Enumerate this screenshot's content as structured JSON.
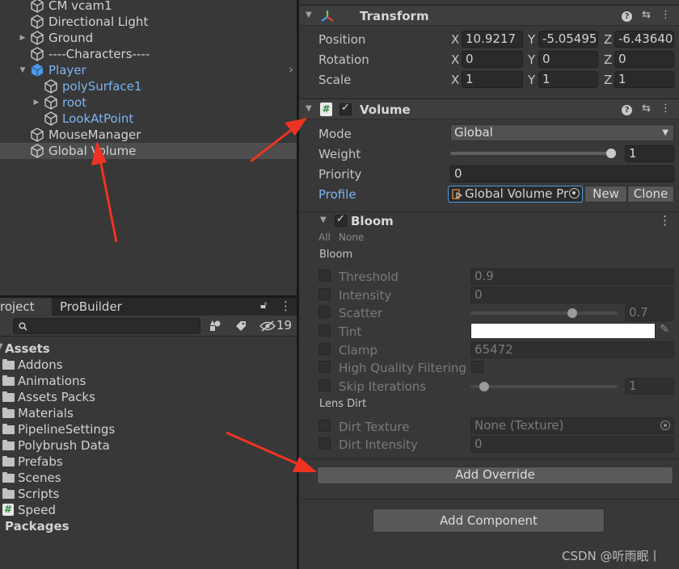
{
  "hierarchy": {
    "items": [
      {
        "label": "CM vcam1"
      },
      {
        "label": "Directional Light"
      },
      {
        "label": "Ground"
      },
      {
        "label": "----Characters----"
      },
      {
        "label": "Player"
      },
      {
        "label": "polySurface1"
      },
      {
        "label": "root"
      },
      {
        "label": "LookAtPoint"
      },
      {
        "label": "MouseManager"
      },
      {
        "label": "Global Volume"
      }
    ]
  },
  "project": {
    "tabs": [
      "roject",
      "ProBuilder"
    ],
    "hidden_count": "19",
    "tree": [
      {
        "label": "Assets",
        "bold": true
      },
      {
        "label": "Addons"
      },
      {
        "label": "Animations"
      },
      {
        "label": "Assets Packs"
      },
      {
        "label": "Materials"
      },
      {
        "label": "PipelineSettings"
      },
      {
        "label": "Polybrush Data"
      },
      {
        "label": "Prefabs"
      },
      {
        "label": "Scenes"
      },
      {
        "label": "Scripts"
      },
      {
        "label": "Speed"
      },
      {
        "label": "Packages",
        "bold": true
      }
    ]
  },
  "inspector": {
    "transform": {
      "title": "Transform",
      "position_label": "Position",
      "rotation_label": "Rotation",
      "scale_label": "Scale",
      "axes": [
        "X",
        "Y",
        "Z"
      ],
      "position": [
        "10.9217",
        "-5.05495",
        "-6.43640"
      ],
      "rotation": [
        "0",
        "0",
        "0"
      ],
      "scale": [
        "1",
        "1",
        "1"
      ]
    },
    "volume": {
      "title": "Volume",
      "mode_label": "Mode",
      "mode_value": "Global",
      "weight_label": "Weight",
      "weight_value": "1",
      "weight_fraction": 1.0,
      "priority_label": "Priority",
      "priority_value": "0",
      "profile_label": "Profile",
      "profile_value": "Global Volume Pr",
      "new_label": "New",
      "clone_label": "Clone"
    },
    "bloom": {
      "title": "Bloom",
      "all_label": "All",
      "none_label": "None",
      "bloom_section": "Bloom",
      "threshold_label": "Threshold",
      "threshold_value": "0.9",
      "intensity_label": "Intensity",
      "intensity_value": "0",
      "scatter_label": "Scatter",
      "scatter_value": "0.7",
      "tint_label": "Tint",
      "tint_color": "#ffffff",
      "clamp_label": "Clamp",
      "clamp_value": "65472",
      "hq_label": "High Quality Filtering",
      "skip_label": "Skip Iterations",
      "skip_value": "1",
      "lens_dirt_section": "Lens Dirt",
      "dirt_texture_label": "Dirt Texture",
      "dirt_texture_value": "None (Texture)",
      "dirt_intensity_label": "Dirt Intensity",
      "dirt_intensity_value": "0"
    },
    "add_override_label": "Add Override",
    "add_component_label": "Add Component"
  },
  "watermark": "CSDN @听雨眠丨",
  "colors": {
    "accent_blue": "#7cb3f0",
    "arrow_red": "#ee3322"
  }
}
